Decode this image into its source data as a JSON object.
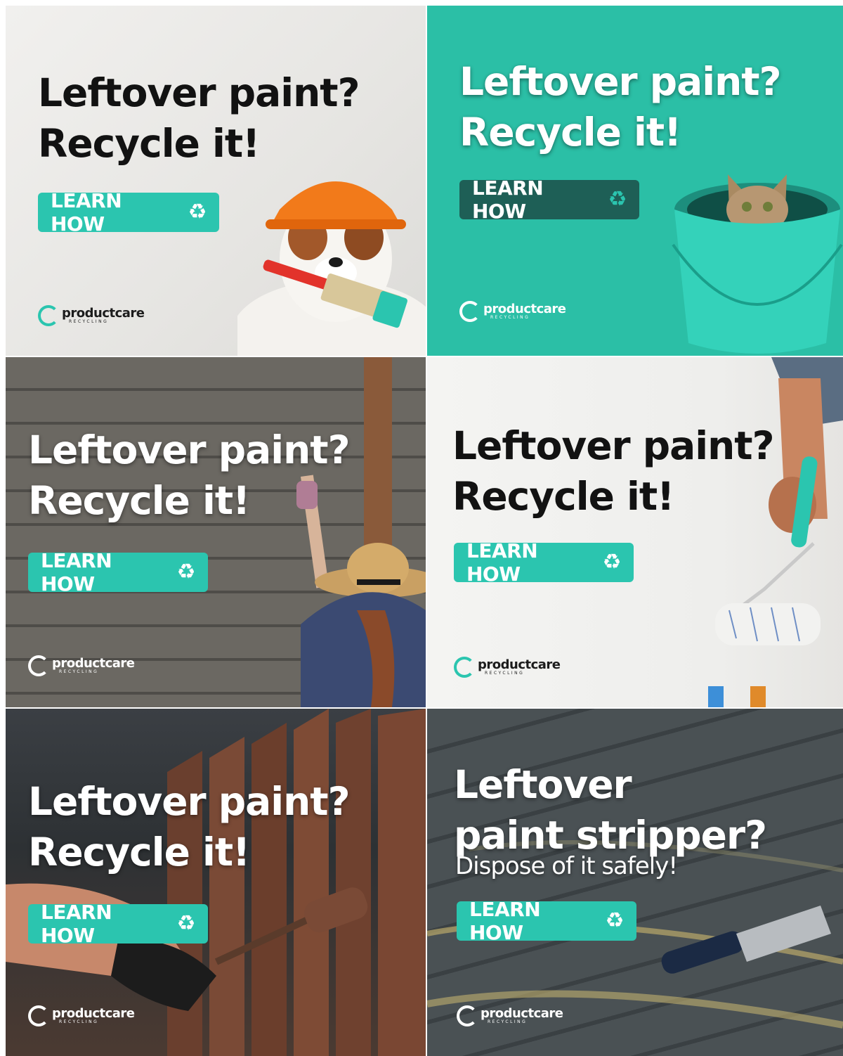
{
  "ads": [
    {
      "headline_line1": "Leftover paint?",
      "headline_line2": "Recycle it!",
      "cta_label": "LEARN HOW",
      "cta_icon": "recycle-icon",
      "logo_brand": "productcare",
      "logo_sub": "RECYCLING"
    },
    {
      "headline_line1": "Leftover paint?",
      "headline_line2": "Recycle it!",
      "cta_label": "LEARN HOW",
      "cta_icon": "recycle-icon",
      "logo_brand": "productcare",
      "logo_sub": "RECYCLING"
    },
    {
      "headline_line1": "Leftover paint?",
      "headline_line2": "Recycle it!",
      "cta_label": "LEARN HOW",
      "cta_icon": "recycle-icon",
      "logo_brand": "productcare",
      "logo_sub": "RECYCLING"
    },
    {
      "headline_line1": "Leftover paint?",
      "headline_line2": "Recycle it!",
      "cta_label": "LEARN HOW",
      "cta_icon": "recycle-icon",
      "logo_brand": "productcare",
      "logo_sub": "RECYCLING"
    },
    {
      "headline_line1": "Leftover paint?",
      "headline_line2": "Recycle it!",
      "cta_label": "LEARN HOW",
      "cta_icon": "recycle-icon",
      "logo_brand": "productcare",
      "logo_sub": "RECYCLING"
    },
    {
      "headline_line1": "Leftover",
      "headline_line2": "paint stripper?",
      "subline": "Dispose of it safely!",
      "cta_label": "LEARN HOW",
      "cta_icon": "recycle-icon",
      "logo_brand": "productcare",
      "logo_sub": "RECYCLING"
    }
  ],
  "colors": {
    "accent": "#2bc5af",
    "teal_background": "#2bbfa6",
    "dark_button": "#1e5f56"
  }
}
